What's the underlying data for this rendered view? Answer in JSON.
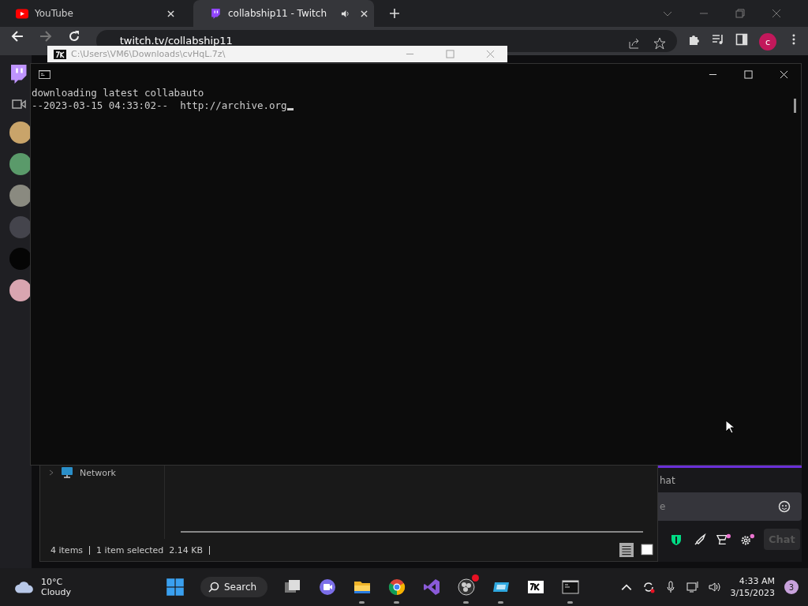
{
  "browser": {
    "tabs": [
      {
        "title": "YouTube",
        "kind": "youtube",
        "selected": false,
        "audio": false
      },
      {
        "title": "collabship11 - Twitch",
        "kind": "twitch",
        "selected": true,
        "audio": true
      }
    ],
    "url": "twitch.tv/collabship11",
    "profile_initial": "c"
  },
  "chat": {
    "header": "hat",
    "input_placeholder": "e",
    "send_button": "Chat",
    "send_disabled": true
  },
  "archive_window": {
    "title": "C:\\Users\\VM6\\Downloads\\cvHqL.7z\\"
  },
  "explorer": {
    "tree": [
      {
        "label": "Network",
        "expanded": false
      }
    ],
    "item_count": "4 items",
    "selection": "1 item selected  2.14 KB"
  },
  "console": {
    "lines": [
      "downloading latest collabauto",
      "--2023-03-15 04:33:02--  http://archive.org"
    ]
  },
  "taskbar": {
    "weather": {
      "temperature": "10°C",
      "condition": "Cloudy"
    },
    "search": "Search",
    "apps": [
      {
        "kind": "taskview",
        "running": false,
        "alert": false
      },
      {
        "kind": "meet",
        "running": false,
        "alert": false
      },
      {
        "kind": "folder",
        "running": true,
        "alert": false
      },
      {
        "kind": "chrome",
        "running": true,
        "alert": false
      },
      {
        "kind": "studio",
        "running": false,
        "alert": false
      },
      {
        "kind": "obs",
        "running": true,
        "alert": true
      },
      {
        "kind": "vbox",
        "running": true,
        "alert": false
      },
      {
        "kind": "zip",
        "running": false,
        "alert": false
      },
      {
        "kind": "terminal",
        "running": true,
        "alert": false
      }
    ],
    "time": "4:33 AM",
    "date": "3/15/2023",
    "notifications": "3"
  }
}
